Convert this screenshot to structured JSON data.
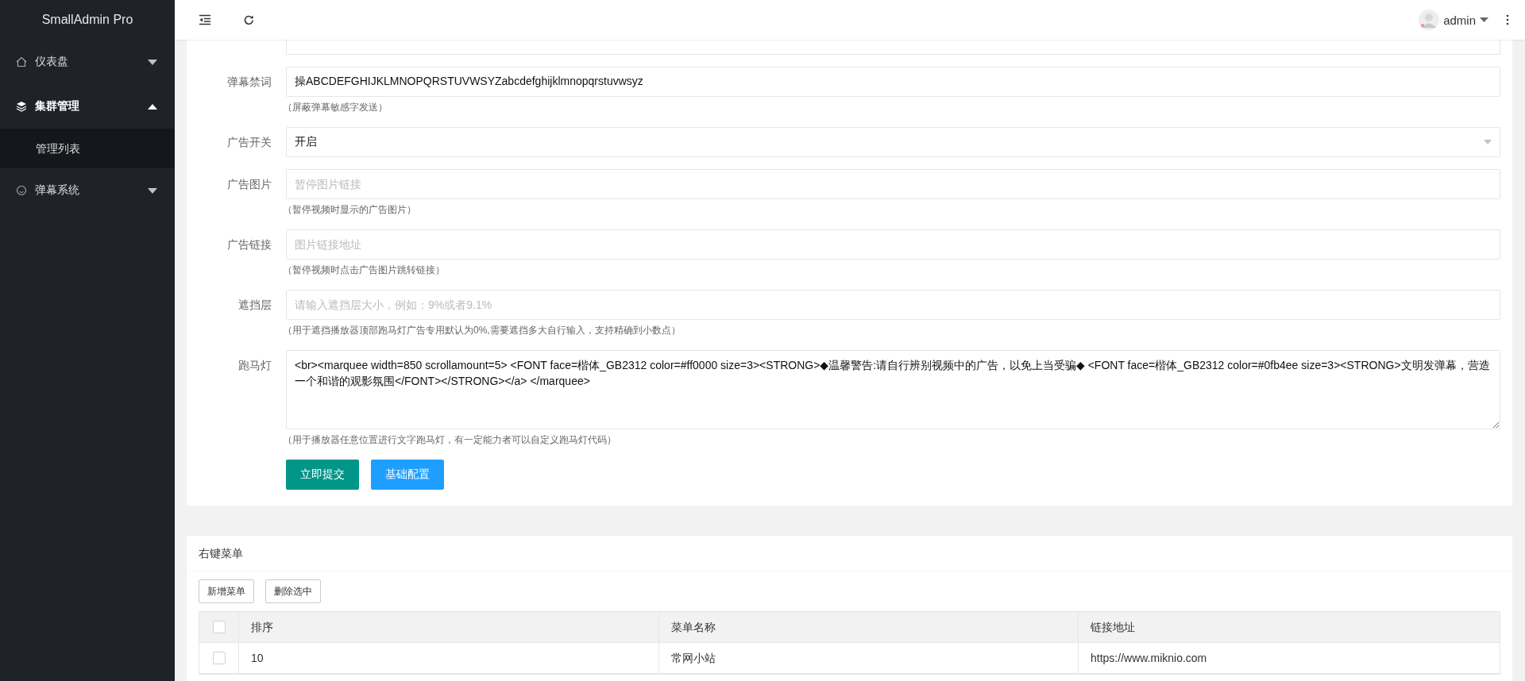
{
  "sidebar": {
    "logo": "SmallAdmin Pro",
    "items": [
      {
        "label": "仪表盘",
        "expanded": false,
        "selected": false
      },
      {
        "label": "集群管理",
        "expanded": true,
        "selected": true,
        "children": [
          {
            "label": "管理列表",
            "selected": false
          }
        ]
      },
      {
        "label": "弹幕系统",
        "expanded": false,
        "selected": false
      }
    ]
  },
  "header": {
    "user": "admin"
  },
  "form": {
    "fields": [
      {
        "kind": "input",
        "label": "弹幕禁词",
        "value": "操ABCDEFGHIJKLMNOPQRSTUVWSYZabcdefghijklmnopqrstuvwsyz",
        "hint": "（屏蔽弹幕敏感字发送）"
      },
      {
        "kind": "select",
        "label": "广告开关",
        "value": "开启"
      },
      {
        "kind": "input",
        "label": "广告图片",
        "placeholder": "暂停图片链接",
        "hint": "（暂停视频时显示的广告图片）"
      },
      {
        "kind": "input",
        "label": "广告链接",
        "placeholder": "图片链接地址",
        "hint": "（暂停视频时点击广告图片跳转链接）"
      },
      {
        "kind": "input",
        "label": "遮挡层",
        "placeholder": "请输入遮挡层大小，例如：9%或者9.1%",
        "hint": "（用于遮挡播放器顶部跑马灯广告专用默认为0%,需要遮挡多大自行输入，支持精确到小数点）"
      },
      {
        "kind": "textarea",
        "label": "跑马灯",
        "value": "<br><marquee width=850 scrollamount=5> <FONT face=楷体_GB2312 color=#ff0000 size=3><STRONG>◆温馨警告:请自行辨别视频中的广告，以免上当受骗◆ <FONT face=楷体_GB2312 color=#0fb4ee size=3><STRONG>文明发弹幕，营造一个和谐的观影氛围</FONT></STRONG></a> </marquee>",
        "hint": "（用于播放器任意位置进行文字跑马灯，有一定能力者可以自定义跑马灯代码）"
      }
    ],
    "buttons": [
      {
        "label": "立即提交",
        "kind": "primary"
      },
      {
        "label": "基础配置",
        "kind": "normal"
      }
    ]
  },
  "context_menu": {
    "title": "右键菜单",
    "buttons": [
      "新增菜单",
      "删除选中"
    ],
    "table": {
      "all_checked": false,
      "columns": [
        "排序",
        "菜单名称",
        "链接地址"
      ],
      "rows": [
        {
          "checked": false,
          "cells": [
            "10",
            "常网小站",
            "https://www.miknio.com"
          ]
        }
      ]
    }
  }
}
